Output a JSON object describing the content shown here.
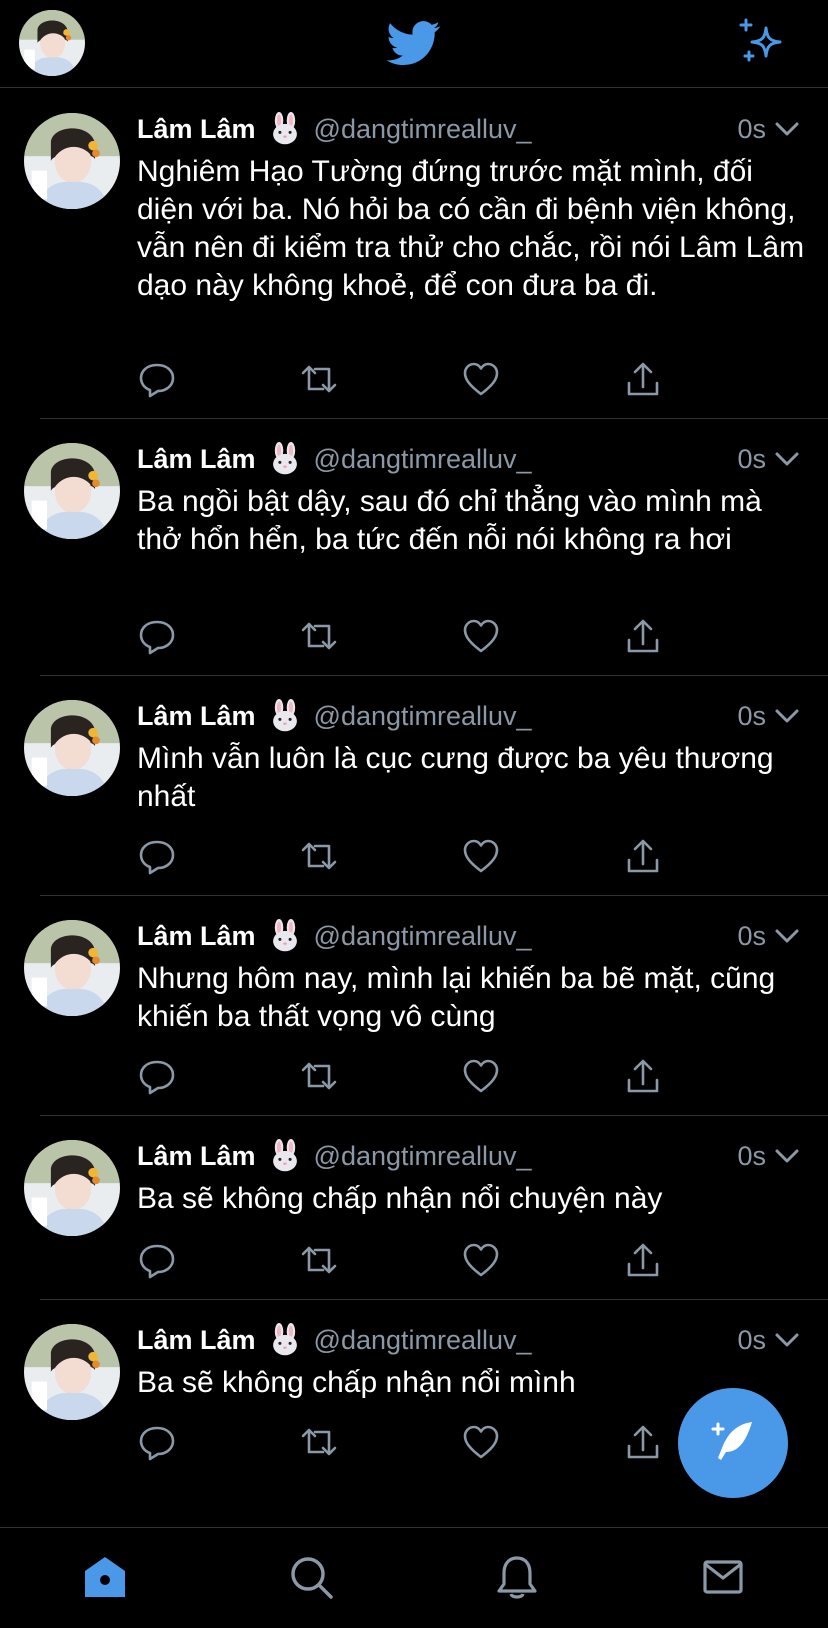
{
  "colors": {
    "accent": "#4a99e9",
    "background": "#000000",
    "secondary_text": "#8b98a5",
    "divider": "#2f3336"
  },
  "header": {
    "avatar_icon": "profile-avatar",
    "logo_icon": "twitter-bird-icon",
    "action_icon": "sparkle-icon"
  },
  "tweets": [
    {
      "name": "Lâm Lâm",
      "emoji": "rabbit-face-icon",
      "handle": "@dangtimrealluv_",
      "time": "0s",
      "text": "Nghiêm Hạo Tường đứng trước mặt mình, đối diện với ba. Nó hỏi ba có cần đi bệnh viện không, vẫn nên đi kiểm tra thử cho chắc, rồi nói Lâm Lâm dạo này không khoẻ, để con đưa ba đi."
    },
    {
      "name": "Lâm Lâm",
      "emoji": "rabbit-face-icon",
      "handle": "@dangtimrealluv_",
      "time": "0s",
      "text": "Ba ngồi bật dậy, sau đó chỉ thẳng vào mình mà thở hổn hển, ba tức đến nỗi nói không ra hơi"
    },
    {
      "name": "Lâm Lâm",
      "emoji": "rabbit-face-icon",
      "handle": "@dangtimrealluv_",
      "time": "0s",
      "text": "Mình vẫn luôn là cục cưng được ba yêu thương nhất"
    },
    {
      "name": "Lâm Lâm",
      "emoji": "rabbit-face-icon",
      "handle": "@dangtimrealluv_",
      "time": "0s",
      "text": "Nhưng hôm nay, mình lại khiến ba bẽ mặt, cũng khiến ba thất vọng vô cùng"
    },
    {
      "name": "Lâm Lâm",
      "emoji": "rabbit-face-icon",
      "handle": "@dangtimrealluv_",
      "time": "0s",
      "text": "Ba sẽ không chấp nhận nổi chuyện này"
    },
    {
      "name": "Lâm Lâm",
      "emoji": "rabbit-face-icon",
      "handle": "@dangtimrealluv_",
      "time": "0s",
      "text": "Ba sẽ không chấp nhận nổi mình"
    }
  ],
  "tweet_actions": [
    "reply-icon",
    "retweet-icon",
    "like-icon",
    "share-icon"
  ],
  "fab": {
    "icon": "compose-tweet-icon"
  },
  "bottom_nav": [
    {
      "icon": "home-icon",
      "active": true
    },
    {
      "icon": "search-icon",
      "active": false
    },
    {
      "icon": "notifications-icon",
      "active": false
    },
    {
      "icon": "messages-icon",
      "active": false
    }
  ]
}
